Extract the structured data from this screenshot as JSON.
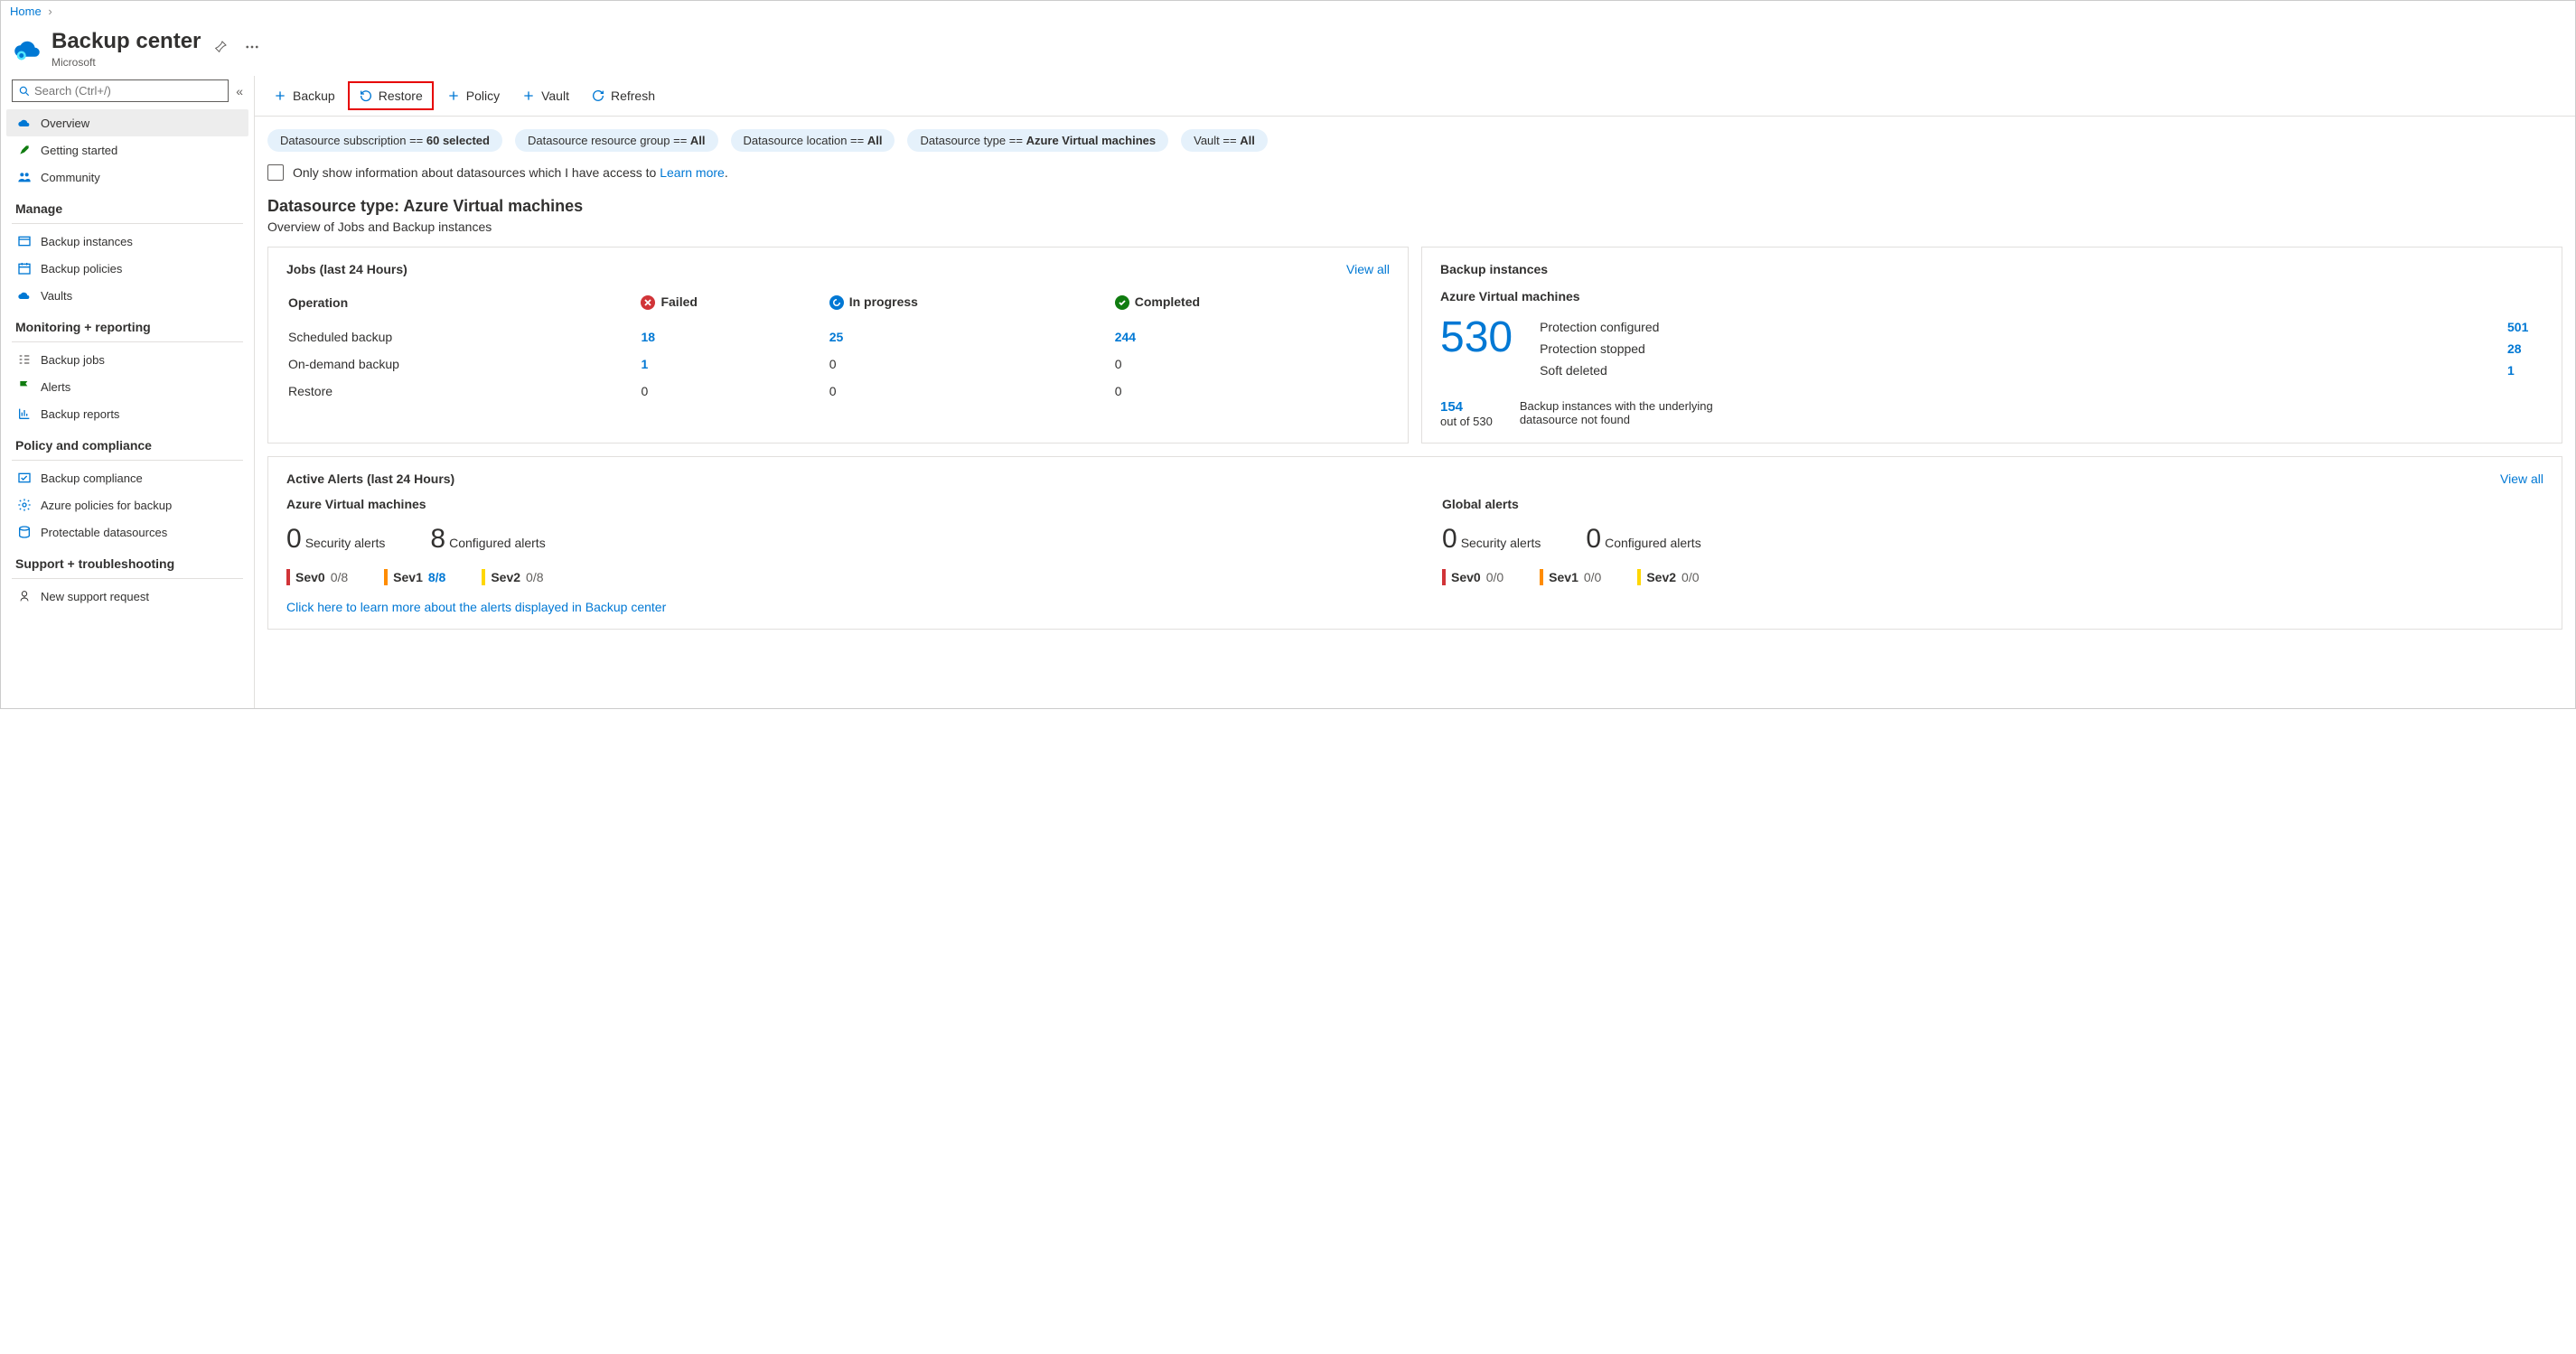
{
  "breadcrumb": {
    "home": "Home"
  },
  "header": {
    "title": "Backup center",
    "subtitle": "Microsoft"
  },
  "search": {
    "placeholder": "Search (Ctrl+/)"
  },
  "sidebar": {
    "top": [
      {
        "label": "Overview",
        "icon": "cloud"
      },
      {
        "label": "Getting started",
        "icon": "rocket"
      },
      {
        "label": "Community",
        "icon": "people"
      }
    ],
    "sections": [
      {
        "title": "Manage",
        "items": [
          {
            "label": "Backup instances",
            "icon": "window"
          },
          {
            "label": "Backup policies",
            "icon": "calendar"
          },
          {
            "label": "Vaults",
            "icon": "cloud2"
          }
        ]
      },
      {
        "title": "Monitoring + reporting",
        "items": [
          {
            "label": "Backup jobs",
            "icon": "tasks"
          },
          {
            "label": "Alerts",
            "icon": "flag"
          },
          {
            "label": "Backup reports",
            "icon": "chart"
          }
        ]
      },
      {
        "title": "Policy and compliance",
        "items": [
          {
            "label": "Backup compliance",
            "icon": "check"
          },
          {
            "label": "Azure policies for backup",
            "icon": "gear"
          },
          {
            "label": "Protectable datasources",
            "icon": "db"
          }
        ]
      },
      {
        "title": "Support + troubleshooting",
        "items": [
          {
            "label": "New support request",
            "icon": "support"
          }
        ]
      }
    ]
  },
  "toolbar": {
    "backup": "Backup",
    "restore": "Restore",
    "policy": "Policy",
    "vault": "Vault",
    "refresh": "Refresh"
  },
  "filters": {
    "subscription_label": "Datasource subscription == ",
    "subscription_value": "60 selected",
    "rg_label": "Datasource resource group == ",
    "rg_value": "All",
    "loc_label": "Datasource location == ",
    "loc_value": "All",
    "type_label": "Datasource type == ",
    "type_value": "Azure Virtual machines",
    "vault_label": "Vault == ",
    "vault_value": "All"
  },
  "checkbox_text": "Only show information about datasources which I have access to ",
  "learn_more": "Learn more",
  "main": {
    "title": "Datasource type: Azure Virtual machines",
    "subtitle": "Overview of Jobs and Backup instances"
  },
  "jobs": {
    "title": "Jobs (last 24 Hours)",
    "viewall": "View all",
    "col_op": "Operation",
    "col_fail": "Failed",
    "col_prog": "In progress",
    "col_comp": "Completed",
    "rows": [
      {
        "op": "Scheduled backup",
        "fail": "18",
        "prog": "25",
        "comp": "244",
        "fail_link": true,
        "prog_link": true,
        "comp_link": true
      },
      {
        "op": "On-demand backup",
        "fail": "1",
        "prog": "0",
        "comp": "0",
        "fail_link": true
      },
      {
        "op": "Restore",
        "fail": "0",
        "prog": "0",
        "comp": "0"
      }
    ]
  },
  "instances": {
    "title": "Backup instances",
    "subtitle": "Azure Virtual machines",
    "total": "530",
    "stats": [
      {
        "label": "Protection configured",
        "value": "501"
      },
      {
        "label": "Protection stopped",
        "value": "28"
      },
      {
        "label": "Soft deleted",
        "value": "1"
      }
    ],
    "sub_n": "154",
    "sub_of": "out of 530",
    "sub_text": "Backup instances with the underlying datasource not found"
  },
  "alerts": {
    "title": "Active Alerts (last 24 Hours)",
    "viewall": "View all",
    "cols": [
      {
        "name": "Azure Virtual machines",
        "sec_n": "0",
        "sec_l": "Security alerts",
        "cfg_n": "8",
        "cfg_l": "Configured alerts",
        "sev": [
          {
            "l": "Sev0",
            "v": "0/8"
          },
          {
            "l": "Sev1",
            "v": "8/8",
            "link": true
          },
          {
            "l": "Sev2",
            "v": "0/8"
          }
        ]
      },
      {
        "name": "Global alerts",
        "sec_n": "0",
        "sec_l": "Security alerts",
        "cfg_n": "0",
        "cfg_l": "Configured alerts",
        "sev": [
          {
            "l": "Sev0",
            "v": "0/0"
          },
          {
            "l": "Sev1",
            "v": "0/0"
          },
          {
            "l": "Sev2",
            "v": "0/0"
          }
        ]
      }
    ],
    "learn": "Click here to learn more about the alerts displayed in Backup center"
  }
}
